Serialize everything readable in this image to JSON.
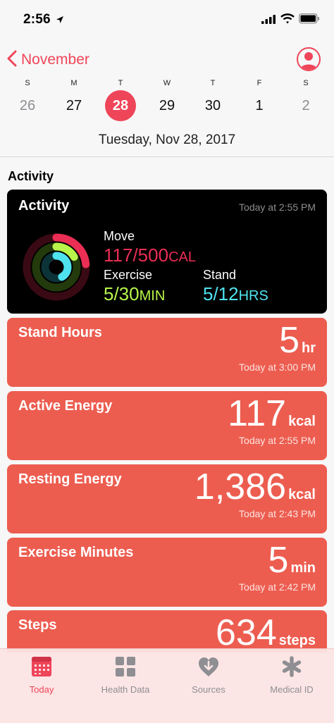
{
  "status_bar": {
    "time": "2:56"
  },
  "nav": {
    "back_label": "November"
  },
  "week": {
    "days": [
      {
        "dow": "S",
        "num": "26"
      },
      {
        "dow": "M",
        "num": "27"
      },
      {
        "dow": "T",
        "num": "28"
      },
      {
        "dow": "W",
        "num": "29"
      },
      {
        "dow": "T",
        "num": "30"
      },
      {
        "dow": "F",
        "num": "1"
      },
      {
        "dow": "S",
        "num": "2"
      }
    ],
    "selected_index": 2,
    "date_label": "Tuesday, Nov 28, 2017"
  },
  "section_title": "Activity",
  "activity": {
    "title": "Activity",
    "time": "Today at 2:55 PM",
    "move": {
      "label": "Move",
      "value": "117/500",
      "unit": "CAL",
      "progress": 0.234
    },
    "exercise": {
      "label": "Exercise",
      "value": "5/30",
      "unit": "MIN",
      "progress": 0.167
    },
    "stand": {
      "label": "Stand",
      "value": "5/12",
      "unit": "HRS",
      "progress": 0.417
    }
  },
  "metrics": [
    {
      "title": "Stand Hours",
      "value": "5",
      "unit": "hr",
      "time": "Today at 3:00 PM"
    },
    {
      "title": "Active Energy",
      "value": "117",
      "unit": "kcal",
      "time": "Today at 2:55 PM"
    },
    {
      "title": "Resting Energy",
      "value": "1,386",
      "unit": "kcal",
      "time": "Today at 2:43 PM"
    },
    {
      "title": "Exercise Minutes",
      "value": "5",
      "unit": "min",
      "time": "Today at 2:42 PM"
    },
    {
      "title": "Steps",
      "value": "634",
      "unit": "steps",
      "time": ""
    }
  ],
  "tabs": [
    {
      "label": "Today",
      "icon": "calendar-icon",
      "active": true
    },
    {
      "label": "Health Data",
      "icon": "grid-icon",
      "active": false
    },
    {
      "label": "Sources",
      "icon": "heart-download-icon",
      "active": false
    },
    {
      "label": "Medical ID",
      "icon": "asterisk-icon",
      "active": false
    }
  ],
  "colors": {
    "accent": "#ef4559",
    "card": "#ec5d50",
    "move": "#ea2e54",
    "exercise": "#b7f54a",
    "stand": "#4fe3f0"
  }
}
